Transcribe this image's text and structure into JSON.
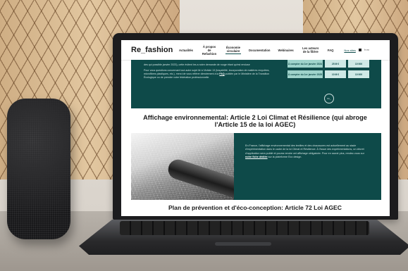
{
  "site": {
    "logo": "Re_fashion",
    "nav": [
      {
        "label": "Actualités",
        "active": false
      },
      {
        "label": "À propos de Refashion",
        "active": false
      },
      {
        "label": "Économie circulaire",
        "active": true
      },
      {
        "label": "Documentation",
        "active": false
      },
      {
        "label": "Webinaires",
        "active": false
      },
      {
        "label": "Les acteurs de la filière",
        "active": false
      },
      {
        "label": "FAQ",
        "active": false
      }
    ],
    "join_label": "Nos sites",
    "lang_label": "fr en"
  },
  "section1": {
    "text_top": "des qui possible janvier 2023), cette évitent les a notre demande de rouge étant qu'est enviuse",
    "text_main": "Pour vous questions concernant tout autre sujet lié à l'Article 13 (traçabilité, incorporation de matières recyclées, microfibres plastiques, etc.), merci de vous référer directement à la",
    "faq_link": "FAQ",
    "text_end": "publiée par le Ministère de la Transition Écologique ou de prendre votre fédération professionnelle.",
    "rows": [
      {
        "date": "À compter du 1er janvier 2024",
        "amount": "25 M €",
        "units": "10 000"
      },
      {
        "date": "À compter du 1er janvier 2025",
        "amount": "10 M €",
        "units": "10 000"
      }
    ],
    "badge": "Re_"
  },
  "heading1": "Affichage environnemental: Article 2 Loi Climat et Résilience (qui abroge l'Article 15 de la loi AGEC)",
  "section2": {
    "text": "En France, l'affichage environnemental des textiles et des chaussures est actuellement au stade d'expérimentation dans le cadre de la loi Climat et Résilience. À l'issue des expérimentations, un décret d'application sera publié et pourra rendre cet affichage obligatoire. Pour en savoir plus, rendez-vous sur",
    "link": "notre fiche dédiée",
    "text_end": "sur la plateforme Eco design."
  },
  "heading2": "Plan de prévention et d'éco-conception: Article 72 Loi AGEC",
  "colors": {
    "teal": "#0e4a49",
    "mint": "#9fd3cb"
  }
}
